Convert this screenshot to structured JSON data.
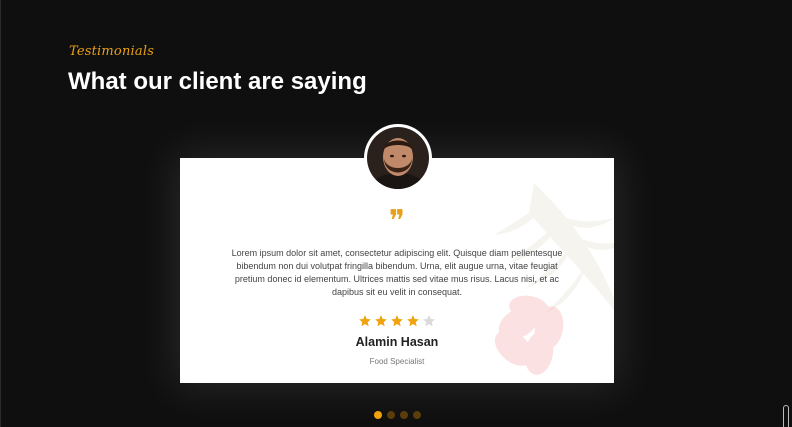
{
  "section": {
    "eyebrow": "Testimonials",
    "title": "What our client are saying"
  },
  "testimonial": {
    "quote_icon": "quote-icon",
    "text": "Lorem ipsum dolor sit amet, consectetur adipiscing elit. Quisque diam pellentesque bibendum non dui volutpat fringilla bibendum. Urna, elit augue urna, vitae feugiat pretium donec id elementum. Ultrices mattis sed vitae mus risus. Lacus nisi, et ac dapibus sit eu velit in consequat.",
    "rating": 4,
    "rating_max": 5,
    "name": "Alamin Hasan",
    "role": "Food Specialist"
  },
  "carousel": {
    "total": 4,
    "active": 0
  },
  "colors": {
    "accent": "#e8a016",
    "star_filled": "#f0a30a",
    "star_empty": "#d9d9d9",
    "dot_inactive": "#5a3d0a",
    "background": "#0f0f0f"
  }
}
